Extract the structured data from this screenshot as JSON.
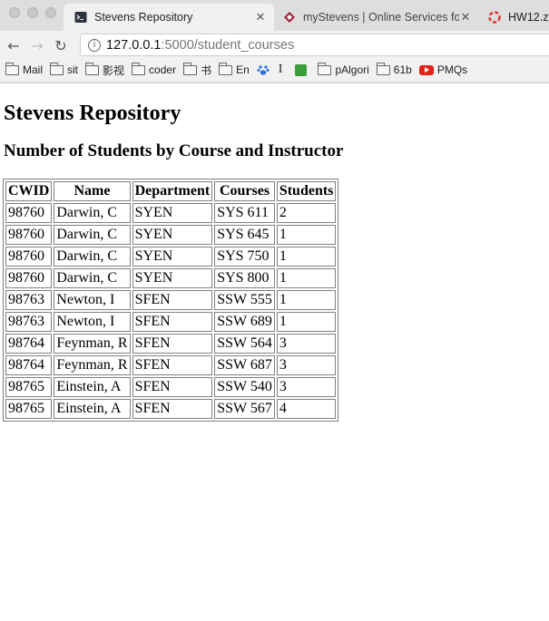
{
  "browser": {
    "tabs": [
      {
        "label": "Stevens Repository",
        "icon": "terminal-icon",
        "active": true
      },
      {
        "label": "myStevens | Online Services fo",
        "icon": "stevens-logo-icon",
        "active": false
      },
      {
        "label": "HW12.z",
        "icon": "lifebuoy-icon",
        "active": false
      }
    ],
    "url_host": "127.0.0.1",
    "url_path": ":5000/student_courses",
    "bookmarks": [
      "Mail",
      "sit",
      "影视",
      "coder",
      "书",
      "En",
      "I",
      "pAlgori",
      "61b",
      "PMQs"
    ]
  },
  "page": {
    "title": "Stevens Repository",
    "subtitle": "Number of Students by Course and Instructor",
    "table": {
      "headers": [
        "CWID",
        "Name",
        "Department",
        "Courses",
        "Students"
      ],
      "rows": [
        [
          "98760",
          "Darwin, C",
          "SYEN",
          "SYS 611",
          "2"
        ],
        [
          "98760",
          "Darwin, C",
          "SYEN",
          "SYS 645",
          "1"
        ],
        [
          "98760",
          "Darwin, C",
          "SYEN",
          "SYS 750",
          "1"
        ],
        [
          "98760",
          "Darwin, C",
          "SYEN",
          "SYS 800",
          "1"
        ],
        [
          "98763",
          "Newton, I",
          "SFEN",
          "SSW 555",
          "1"
        ],
        [
          "98763",
          "Newton, I",
          "SFEN",
          "SSW 689",
          "1"
        ],
        [
          "98764",
          "Feynman, R",
          "SFEN",
          "SSW 564",
          "3"
        ],
        [
          "98764",
          "Feynman, R",
          "SFEN",
          "SSW 687",
          "3"
        ],
        [
          "98765",
          "Einstein, A",
          "SFEN",
          "SSW 540",
          "3"
        ],
        [
          "98765",
          "Einstein, A",
          "SFEN",
          "SSW 567",
          "4"
        ]
      ]
    }
  }
}
